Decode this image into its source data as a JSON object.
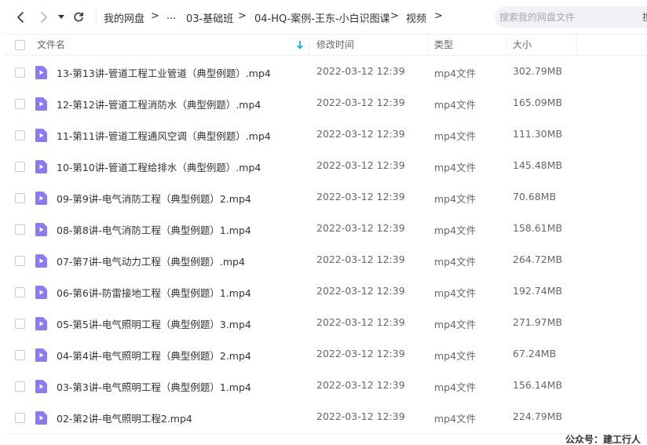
{
  "toolbar": {
    "breadcrumb": [
      {
        "label": "我的网盘"
      },
      {
        "label": "..."
      },
      {
        "label": "03-基础班"
      },
      {
        "label": "04-HQ-案例-王东-小白识图课"
      },
      {
        "label": "视频"
      }
    ],
    "separator": ">",
    "search_placeholder": "搜索我的网盘文件",
    "search_cut_text": "搜"
  },
  "table": {
    "columns": {
      "name": "文件名",
      "modified": "修改时间",
      "type": "类型",
      "size": "大小"
    },
    "rows": [
      {
        "name": "13-第13讲-管道工程工业管道（典型例题）.mp4",
        "modified": "2022-03-12 12:39",
        "type": "mp4文件",
        "size": "302.79MB"
      },
      {
        "name": "12-第12讲-管道工程消防水（典型例题）.mp4",
        "modified": "2022-03-12 12:39",
        "type": "mp4文件",
        "size": "165.09MB"
      },
      {
        "name": "11-第11讲-管道工程通风空调（典型例题）.mp4",
        "modified": "2022-03-12 12:39",
        "type": "mp4文件",
        "size": "111.30MB"
      },
      {
        "name": "10-第10讲-管道工程给排水（典型例题）.mp4",
        "modified": "2022-03-12 12:39",
        "type": "mp4文件",
        "size": "145.48MB"
      },
      {
        "name": "09-第9讲-电气消防工程（典型例题）2.mp4",
        "modified": "2022-03-12 12:39",
        "type": "mp4文件",
        "size": "70.68MB"
      },
      {
        "name": "08-第8讲-电气消防工程（典型例题）1.mp4",
        "modified": "2022-03-12 12:39",
        "type": "mp4文件",
        "size": "158.61MB"
      },
      {
        "name": "07-第7讲-电气动力工程（典型例题）.mp4",
        "modified": "2022-03-12 12:39",
        "type": "mp4文件",
        "size": "264.72MB"
      },
      {
        "name": "06-第6讲-防雷接地工程（典型例题）1.mp4",
        "modified": "2022-03-12 12:39",
        "type": "mp4文件",
        "size": "192.74MB"
      },
      {
        "name": "05-第5讲-电气照明工程（典型例题）3.mp4",
        "modified": "2022-03-12 12:39",
        "type": "mp4文件",
        "size": "271.97MB"
      },
      {
        "name": "04-第4讲-电气照明工程（典型例题）2.mp4",
        "modified": "2022-03-12 12:39",
        "type": "mp4文件",
        "size": "67.24MB"
      },
      {
        "name": "03-第3讲-电气照明工程（典型例题）1.mp4",
        "modified": "2022-03-12 12:39",
        "type": "mp4文件",
        "size": "156.14MB"
      },
      {
        "name": "02-第2讲-电气照明工程2.mp4",
        "modified": "2022-03-12 12:39",
        "type": "mp4文件",
        "size": "224.79MB"
      }
    ]
  },
  "icons": {
    "back": "chevron-left-icon",
    "forward": "chevron-right-icon",
    "history": "caret-down-icon",
    "refresh": "refresh-icon",
    "sort": "arrow-down-icon",
    "file": "video-file-icon"
  },
  "colors": {
    "video_icon": "#8b7bf0",
    "sort_arrow": "#06a7ff",
    "search_bg": "#f1f2f6"
  },
  "watermark": "公众号：建工行人"
}
